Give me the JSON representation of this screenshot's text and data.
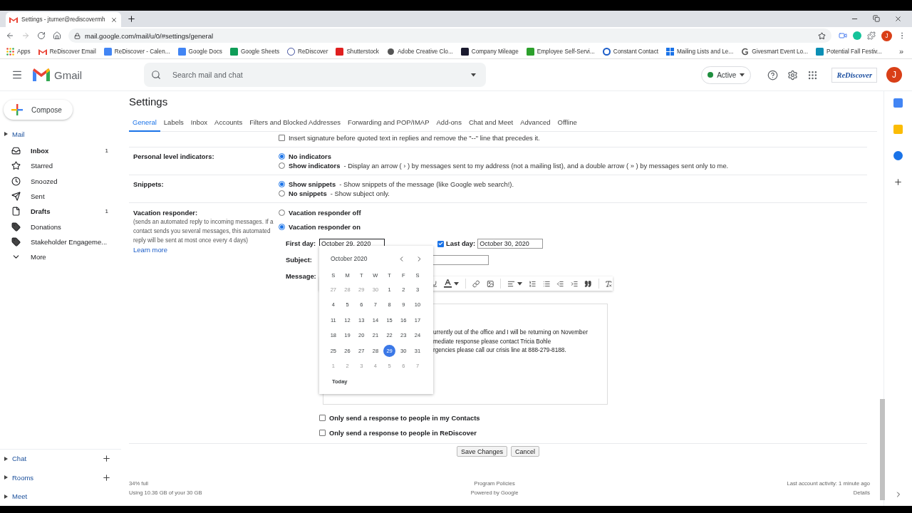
{
  "browser": {
    "tab_title": "Settings - jturner@rediscovermh",
    "url": "mail.google.com/mail/u/0/#settings/general",
    "profile_initial": "J",
    "bookmarks": [
      {
        "label": "Apps",
        "kind": "apps"
      },
      {
        "label": "ReDiscover Email",
        "kind": "gmail"
      },
      {
        "label": "ReDiscover - Calen...",
        "kind": "calendar"
      },
      {
        "label": "Google Docs",
        "kind": "docs"
      },
      {
        "label": "Google Sheets",
        "kind": "sheets"
      },
      {
        "label": "ReDiscover",
        "kind": "letter"
      },
      {
        "label": "Shutterstock",
        "kind": "shutterstock"
      },
      {
        "label": "Adobe Creative Clo...",
        "kind": "adobe"
      },
      {
        "label": "Company Mileage",
        "kind": "mileage"
      },
      {
        "label": "Employee Self-Servi...",
        "kind": "employee"
      },
      {
        "label": "Constant Contact",
        "kind": "contact"
      },
      {
        "label": "Mailing Lists and Le...",
        "kind": "windows"
      },
      {
        "label": "Givesmart Event Lo...",
        "kind": "givesmart"
      },
      {
        "label": "Potential Fall Festiv...",
        "kind": "festival"
      }
    ],
    "bookmarks_more": "»"
  },
  "header": {
    "product": "Gmail",
    "search_placeholder": "Search mail and chat",
    "status": "Active",
    "brand": "ReDiscover",
    "avatar": "J"
  },
  "sidebar": {
    "compose": "Compose",
    "section": "Mail",
    "items": [
      {
        "label": "Inbox",
        "kind": "inbox",
        "count": "1",
        "unread": true
      },
      {
        "label": "Starred",
        "kind": "star",
        "unread": false
      },
      {
        "label": "Snoozed",
        "kind": "clock",
        "unread": false
      },
      {
        "label": "Sent",
        "kind": "send",
        "unread": false
      },
      {
        "label": "Drafts",
        "kind": "draft",
        "count": "1",
        "unread": true
      },
      {
        "label": "Donations",
        "kind": "label",
        "unread": false
      },
      {
        "label": "Stakeholder Engageme...",
        "kind": "label",
        "unread": false
      },
      {
        "label": "More",
        "kind": "more",
        "unread": false
      }
    ],
    "sections": [
      {
        "label": "Chat",
        "can_add": true
      },
      {
        "label": "Rooms",
        "can_add": true
      },
      {
        "label": "Meet",
        "can_add": false
      }
    ]
  },
  "settings": {
    "title": "Settings",
    "tabs": [
      {
        "label": "General",
        "selected": true
      },
      {
        "label": "Labels",
        "selected": false
      },
      {
        "label": "Inbox",
        "selected": false
      },
      {
        "label": "Accounts",
        "selected": false
      },
      {
        "label": "Filters and Blocked Addresses",
        "selected": false
      },
      {
        "label": "Forwarding and POP/IMAP",
        "selected": false
      },
      {
        "label": "Add-ons",
        "selected": false
      },
      {
        "label": "Chat and Meet",
        "selected": false
      },
      {
        "label": "Advanced",
        "selected": false
      },
      {
        "label": "Offline",
        "selected": false
      }
    ],
    "signature_option": {
      "label": "Insert signature before quoted text in replies and remove the \"--\" line that precedes it.",
      "checked": false
    },
    "sections": [
      {
        "label": "Personal level indicators:",
        "options": [
          {
            "label": "No indicators",
            "selected": true
          },
          {
            "label": "Show indicators",
            "detail": "- Display an arrow ( › ) by messages sent to my address (not a mailing list), and a double arrow ( » ) by messages sent only to me.",
            "selected": false
          }
        ]
      },
      {
        "label": "Snippets:",
        "options": [
          {
            "label": "Show snippets",
            "detail": "- Show snippets of the message (like Google web search!).",
            "selected": true
          },
          {
            "label": "No snippets",
            "detail": "- Show subject only.",
            "selected": false
          }
        ]
      }
    ],
    "vacation": {
      "label": "Vacation responder:",
      "description": "(sends an automated reply to incoming messages. If a contact sends you several messages, this automated reply will be sent at most once every 4 days)",
      "learn_more": "Learn more",
      "options": [
        {
          "label": "Vacation responder off",
          "selected": false
        },
        {
          "label": "Vacation responder on",
          "selected": true
        }
      ],
      "first_day_label": "First day:",
      "first_day": "October 29, 2020",
      "last_day_enabled": true,
      "last_day_label": "Last day:",
      "last_day": "October 30, 2020",
      "subject_label": "Subject:",
      "message_label": "Message:",
      "message_lines": [
        "urrently out of the office and I will be returning on November",
        "mediate response please contact Tricia Bohle",
        "rgencies please call our crisis line at 888-279-8188."
      ],
      "restrictions": [
        {
          "label": "Only send a response to people in my Contacts",
          "checked": false
        },
        {
          "label": "Only send a response to people in ReDiscover",
          "checked": false
        }
      ]
    },
    "date_picker": {
      "month": "October 2020",
      "weekdays": [
        "S",
        "M",
        "T",
        "W",
        "T",
        "F",
        "S"
      ],
      "weeks": [
        [
          {
            "day": "27",
            "in_month": false,
            "selected": false
          },
          {
            "day": "28",
            "in_month": false,
            "selected": false
          },
          {
            "day": "29",
            "in_month": false,
            "selected": false
          },
          {
            "day": "30",
            "in_month": false,
            "selected": false
          },
          {
            "day": "1",
            "in_month": true,
            "selected": false
          },
          {
            "day": "2",
            "in_month": true,
            "selected": false
          },
          {
            "day": "3",
            "in_month": true,
            "selected": false
          }
        ],
        [
          {
            "day": "4",
            "in_month": true,
            "selected": false
          },
          {
            "day": "5",
            "in_month": true,
            "selected": false
          },
          {
            "day": "6",
            "in_month": true,
            "selected": false
          },
          {
            "day": "7",
            "in_month": true,
            "selected": false
          },
          {
            "day": "8",
            "in_month": true,
            "selected": false
          },
          {
            "day": "9",
            "in_month": true,
            "selected": false
          },
          {
            "day": "10",
            "in_month": true,
            "selected": false
          }
        ],
        [
          {
            "day": "11",
            "in_month": true,
            "selected": false
          },
          {
            "day": "12",
            "in_month": true,
            "selected": false
          },
          {
            "day": "13",
            "in_month": true,
            "selected": false
          },
          {
            "day": "14",
            "in_month": true,
            "selected": false
          },
          {
            "day": "15",
            "in_month": true,
            "selected": false
          },
          {
            "day": "16",
            "in_month": true,
            "selected": false
          },
          {
            "day": "17",
            "in_month": true,
            "selected": false
          }
        ],
        [
          {
            "day": "18",
            "in_month": true,
            "selected": false
          },
          {
            "day": "19",
            "in_month": true,
            "selected": false
          },
          {
            "day": "20",
            "in_month": true,
            "selected": false
          },
          {
            "day": "21",
            "in_month": true,
            "selected": false
          },
          {
            "day": "22",
            "in_month": true,
            "selected": false
          },
          {
            "day": "23",
            "in_month": true,
            "selected": false
          },
          {
            "day": "24",
            "in_month": true,
            "selected": false
          }
        ],
        [
          {
            "day": "25",
            "in_month": true,
            "selected": false
          },
          {
            "day": "26",
            "in_month": true,
            "selected": false
          },
          {
            "day": "27",
            "in_month": true,
            "selected": false
          },
          {
            "day": "28",
            "in_month": true,
            "selected": false
          },
          {
            "day": "29",
            "in_month": true,
            "selected": true
          },
          {
            "day": "30",
            "in_month": true,
            "selected": false
          },
          {
            "day": "31",
            "in_month": true,
            "selected": false
          }
        ],
        [
          {
            "day": "1",
            "in_month": false,
            "selected": false
          },
          {
            "day": "2",
            "in_month": false,
            "selected": false
          },
          {
            "day": "3",
            "in_month": false,
            "selected": false
          },
          {
            "day": "4",
            "in_month": false,
            "selected": false
          },
          {
            "day": "5",
            "in_month": false,
            "selected": false
          },
          {
            "day": "6",
            "in_month": false,
            "selected": false
          },
          {
            "day": "7",
            "in_month": false,
            "selected": false
          }
        ]
      ],
      "today": "Today"
    },
    "buttons": [
      {
        "label": "Save Changes"
      },
      {
        "label": "Cancel"
      }
    ]
  },
  "footer": {
    "storage_percent": "34% full",
    "storage_usage": "Using 10.36 GB of your 30 GB",
    "policies": "Program Policies",
    "powered_by": "Powered by Google",
    "activity": "Last account activity: 1 minute ago",
    "details": "Details"
  }
}
